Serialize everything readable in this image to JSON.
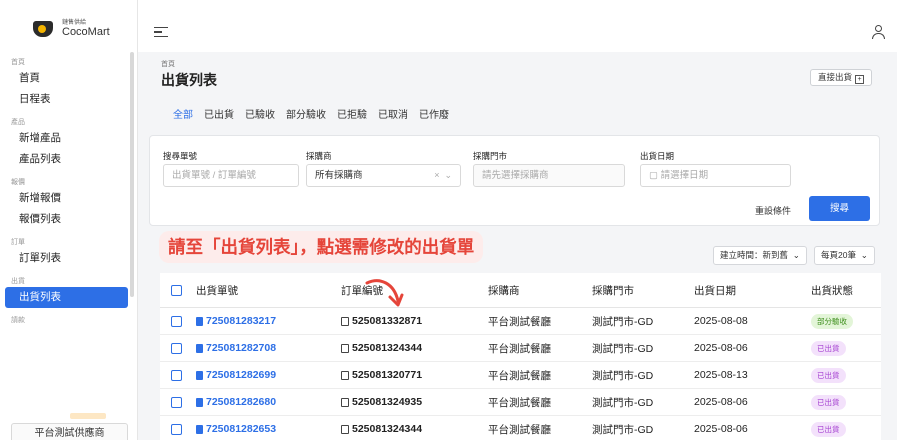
{
  "brand": {
    "sub": "鏈售供給",
    "name": "CocoMart"
  },
  "sidebar": {
    "groups": [
      {
        "label": "首頁",
        "items": [
          "首頁",
          "日程表"
        ]
      },
      {
        "label": "產品",
        "items": [
          "新增產品",
          "產品列表"
        ]
      },
      {
        "label": "報價",
        "items": [
          "新增報價",
          "報價列表"
        ]
      },
      {
        "label": "訂單",
        "items": [
          "訂單列表"
        ]
      },
      {
        "label": "出貨",
        "items": [
          "出貨列表"
        ]
      },
      {
        "label": "請款",
        "items": []
      }
    ],
    "active_item": "出貨列表",
    "footer_label": "平台測試供應商"
  },
  "page": {
    "breadcrumb": "首頁",
    "title": "出貨列表",
    "direct_ship_label": "直接出貨",
    "direct_ship_icon": "plus-box-icon"
  },
  "tabs": [
    "全部",
    "已出貨",
    "已驗收",
    "部分驗收",
    "已拒驗",
    "已取消",
    "已作廢"
  ],
  "active_tab": "全部",
  "filters": {
    "ship_no": {
      "label": "搜尋單號",
      "placeholder": "出貨單號 / 訂單編號"
    },
    "purchaser": {
      "label": "採購商",
      "value": "所有採購商"
    },
    "store": {
      "label": "採購門市",
      "placeholder": "請先選擇採購商"
    },
    "ship_date": {
      "label": "出貨日期",
      "placeholder": "請選擇日期"
    },
    "reset_label": "重設條件",
    "search_label": "搜尋"
  },
  "instruction": "請至「出貨列表」，點選需修改的出貨單",
  "sort": {
    "order": "建立時間：新到舊",
    "page_size": "每頁20筆"
  },
  "table": {
    "headers": [
      "出貨單號",
      "訂單編號",
      "採購商",
      "採購門市",
      "出貨日期",
      "出貨狀態"
    ],
    "rows": [
      {
        "ship_no": "725081283217",
        "order_no": "525081332871",
        "purchaser": "平台測試餐廳",
        "store": "測試門市-GD",
        "date": "2025-08-08",
        "status": "部分驗收"
      },
      {
        "ship_no": "725081282708",
        "order_no": "525081324344",
        "purchaser": "平台測試餐廳",
        "store": "測試門市-GD",
        "date": "2025-08-06",
        "status": "已出貨"
      },
      {
        "ship_no": "725081282699",
        "order_no": "525081320771",
        "purchaser": "平台測試餐廳",
        "store": "測試門市-GD",
        "date": "2025-08-13",
        "status": "已出貨"
      },
      {
        "ship_no": "725081282680",
        "order_no": "525081324935",
        "purchaser": "平台測試餐廳",
        "store": "測試門市-GD",
        "date": "2025-08-06",
        "status": "已出貨"
      },
      {
        "ship_no": "725081282653",
        "order_no": "525081324344",
        "purchaser": "平台測試餐廳",
        "store": "測試門市-GD",
        "date": "2025-08-06",
        "status": "已出貨"
      }
    ]
  },
  "colors": {
    "primary": "#2d6fe6",
    "instruction": "#e5453a",
    "partial": "#3f8f1e",
    "shipped": "#a43fd0"
  }
}
